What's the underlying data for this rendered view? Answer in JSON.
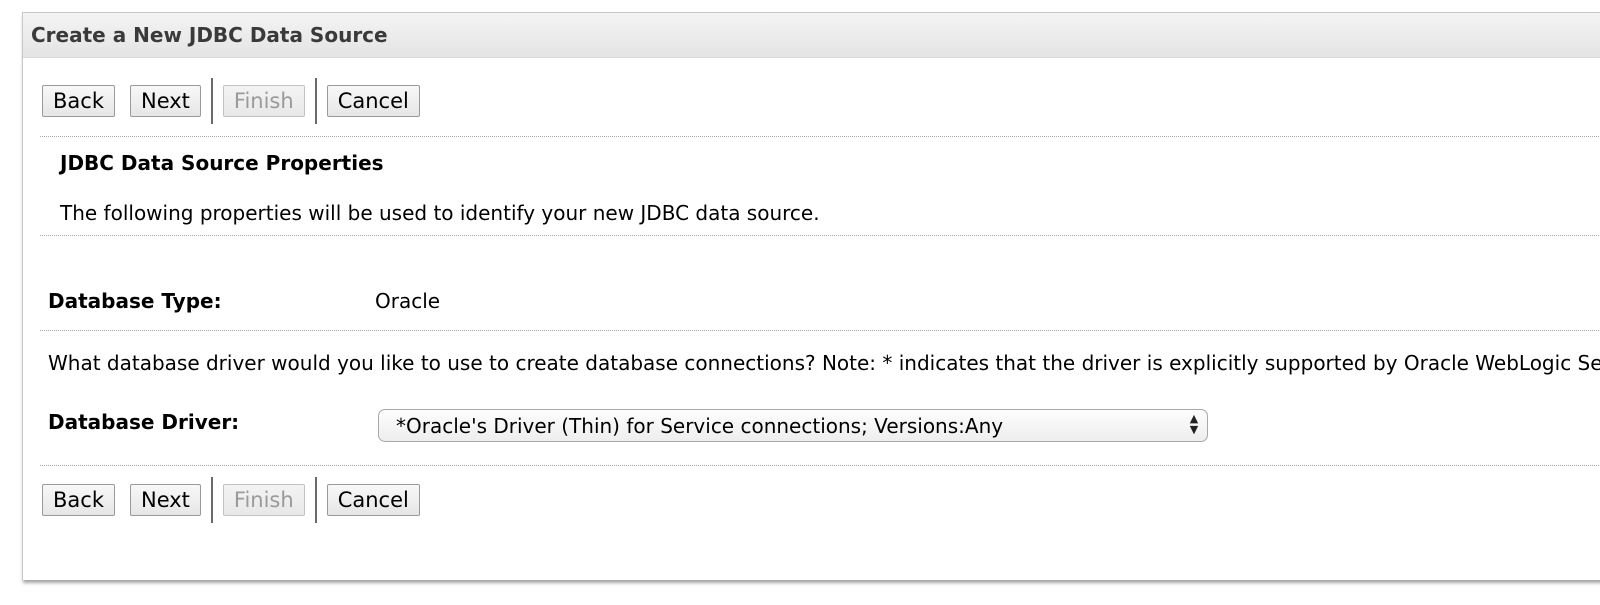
{
  "panel": {
    "title": "Create a New JDBC Data Source"
  },
  "buttons": {
    "back": "Back",
    "next": "Next",
    "finish": "Finish",
    "cancel": "Cancel"
  },
  "section": {
    "title": "JDBC Data Source Properties",
    "description": "The following properties will be used to identify your new JDBC data source."
  },
  "database_type": {
    "label": "Database Type:",
    "value": "Oracle"
  },
  "driver_question": "What database driver would you like to use to create database connections? Note: * indicates that the driver is explicitly supported by Oracle WebLogic Server.",
  "database_driver": {
    "label": "Database Driver:",
    "selected": "*Oracle's Driver (Thin) for Service connections; Versions:Any"
  },
  "icons": {
    "select_arrows": "up-down-arrows-icon"
  }
}
